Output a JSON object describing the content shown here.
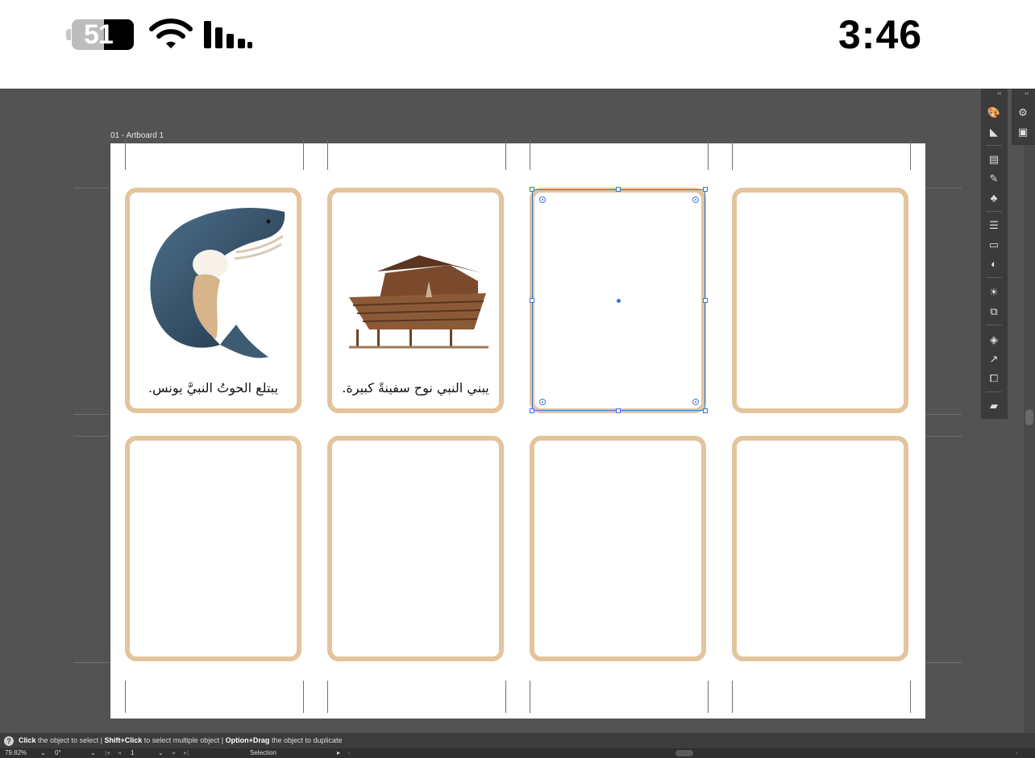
{
  "status_bar": {
    "battery_percent": "51",
    "time": "3:46"
  },
  "artboard": {
    "label": "01 - Artboard 1"
  },
  "cards": [
    {
      "text": "يبتلع الحوتُ النبيَّ يونس.",
      "image": "whale-illustration"
    },
    {
      "text": "يبني النبي نوح سفينةً كبيرة.",
      "image": "ark-illustration"
    },
    {
      "text": ""
    },
    {
      "text": ""
    },
    {
      "text": ""
    },
    {
      "text": ""
    },
    {
      "text": ""
    },
    {
      "text": ""
    }
  ],
  "hint_bar": {
    "click": "Click",
    "click_desc": "the object to select",
    "shift_click": "Shift+Click",
    "shift_click_desc": "to select multiple object",
    "option_drag": "Option+Drag",
    "option_drag_desc": "the object to duplicate",
    "sep": "|"
  },
  "status_line": {
    "zoom": "79.82%",
    "rotation": "0°",
    "artboard_number": "1",
    "tool": "Selection"
  },
  "colors": {
    "card_border": "#e3c49c",
    "selection": "#3a76d6",
    "workspace": "#535353"
  }
}
